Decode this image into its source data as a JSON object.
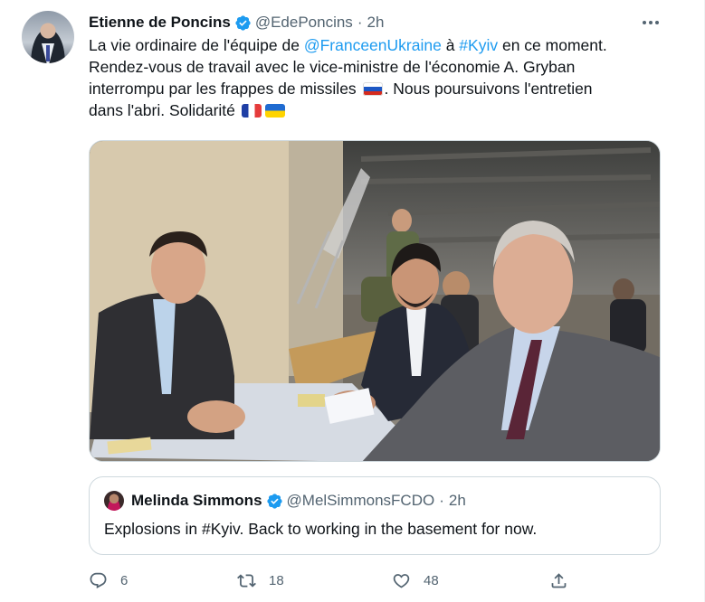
{
  "tweet": {
    "author_name": "Etienne de Poncins",
    "handle": "@EdePoncins",
    "separator": "·",
    "time": "2h",
    "text_lines": [
      [
        {
          "t": "La vie ordinaire de l'équipe de "
        },
        {
          "t": "@FranceenUkraine",
          "link": true
        },
        {
          "t": " à "
        },
        {
          "t": "#Kyiv",
          "link": true
        },
        {
          "t": " en ce moment."
        }
      ],
      [
        {
          "t": "Rendez-vous de travail avec le vice-ministre de l'économie A. Gryban"
        }
      ],
      [
        {
          "t": "interrompu par les frappes de missiles "
        },
        {
          "flag": "ru"
        },
        {
          "t": ". Nous poursuivons l'entretien"
        }
      ],
      [
        {
          "t": "dans l'abri. Solidarité "
        },
        {
          "flag": "fr"
        },
        {
          "flag": "ua"
        }
      ]
    ]
  },
  "quoted": {
    "author_name": "Melinda Simmons",
    "handle": "@MelSimmonsFCDO",
    "separator": "·",
    "time": "2h",
    "text": "Explosions in #Kyiv. Back to working in the basement for now."
  },
  "actions": {
    "reply_count": "6",
    "retweet_count": "18",
    "like_count": "48"
  },
  "colors": {
    "link": "#1d9bf0",
    "muted": "#536471",
    "verified": "#1d9bf0"
  },
  "icons": [
    "verified-badge-icon",
    "more-options-icon",
    "reply-icon",
    "retweet-icon",
    "like-icon",
    "share-icon"
  ]
}
